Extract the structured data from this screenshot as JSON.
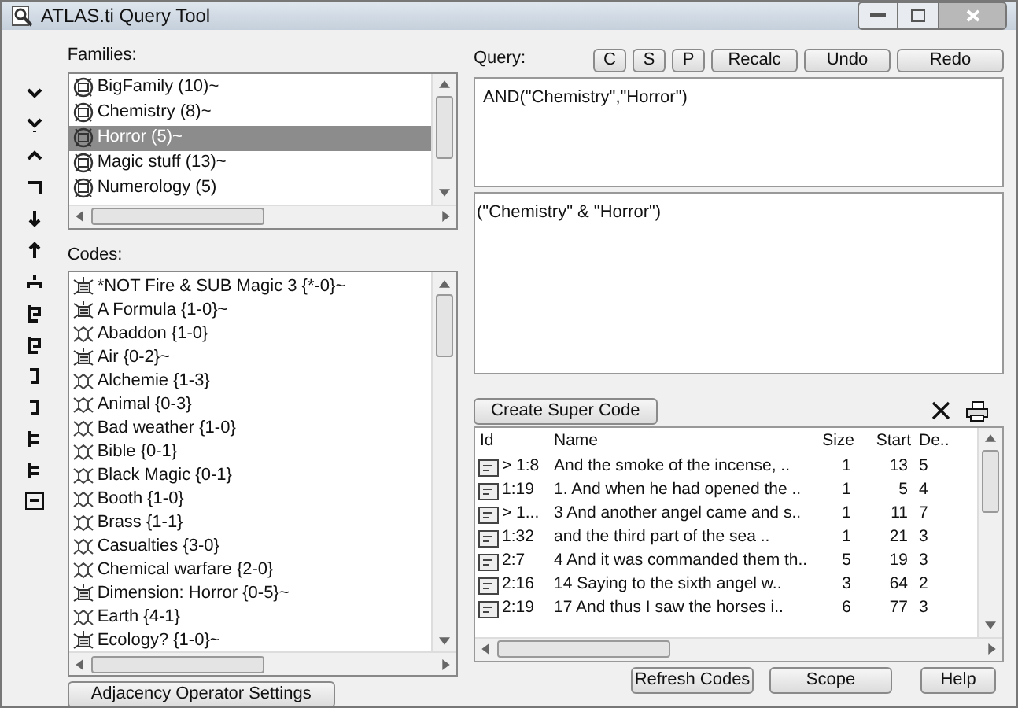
{
  "window": {
    "title": "ATLAS.ti Query Tool"
  },
  "families": {
    "label": "Families:",
    "items": [
      {
        "name": "BigFamily (10)~",
        "selected": false
      },
      {
        "name": "Chemistry (8)~",
        "selected": false
      },
      {
        "name": "Horror (5)~",
        "selected": true
      },
      {
        "name": "Magic stuff (13)~",
        "selected": false
      },
      {
        "name": "Numerology (5)",
        "selected": false
      }
    ]
  },
  "codes": {
    "label": "Codes:",
    "items": [
      {
        "name": "*NOT Fire & SUB Magic 3 {*-0}~",
        "kind": "super"
      },
      {
        "name": "A Formula {1-0}~",
        "kind": "super"
      },
      {
        "name": "Abaddon {1-0}",
        "kind": "code"
      },
      {
        "name": "Air {0-2}~",
        "kind": "super"
      },
      {
        "name": "Alchemie {1-3}",
        "kind": "code"
      },
      {
        "name": "Animal {0-3}",
        "kind": "code"
      },
      {
        "name": "Bad weather {1-0}",
        "kind": "code"
      },
      {
        "name": "Bible {0-1}",
        "kind": "code"
      },
      {
        "name": "Black Magic {0-1}",
        "kind": "code"
      },
      {
        "name": "Booth {1-0}",
        "kind": "code"
      },
      {
        "name": "Brass {1-1}",
        "kind": "code"
      },
      {
        "name": "Casualties {3-0}",
        "kind": "code"
      },
      {
        "name": "Chemical warfare {2-0}",
        "kind": "code"
      },
      {
        "name": "Dimension: Horror {0-5}~",
        "kind": "super"
      },
      {
        "name": "Earth {4-1}",
        "kind": "code"
      },
      {
        "name": "Ecology? {1-0}~",
        "kind": "super"
      }
    ]
  },
  "adjacency_button": "Adjacency Operator Settings",
  "query": {
    "label": "Query:",
    "buttons": [
      "C",
      "S",
      "P",
      "Recalc",
      "Undo",
      "Redo"
    ],
    "text": "AND(\"Chemistry\",\"Horror\")",
    "result": "(\"Chemistry\" & \"Horror\")"
  },
  "create_button": "Create Super Code",
  "table": {
    "columns": [
      "Id",
      "Name",
      "Size",
      "Start",
      "De.."
    ],
    "rows": [
      [
        "> 1:8",
        "And the smoke of the incense, ..",
        "1",
        "13",
        "5"
      ],
      [
        "1:19",
        "1. And when he had opened the ..",
        "1",
        "5",
        "4"
      ],
      [
        "> 1...",
        "3 And another angel came and s..",
        "1",
        "11",
        "7"
      ],
      [
        "1:32",
        "and the third part of the sea ..",
        "1",
        "21",
        "3"
      ],
      [
        "2:7",
        "4 And it was commanded them th..",
        "5",
        "19",
        "3"
      ],
      [
        "2:16",
        "14 Saying to the sixth angel w..",
        "3",
        "64",
        "2"
      ],
      [
        "2:19",
        "17 And thus I saw the horses i..",
        "6",
        "77",
        "3"
      ]
    ]
  },
  "bottom_buttons": [
    "Refresh Codes",
    "Scope",
    "Help"
  ]
}
